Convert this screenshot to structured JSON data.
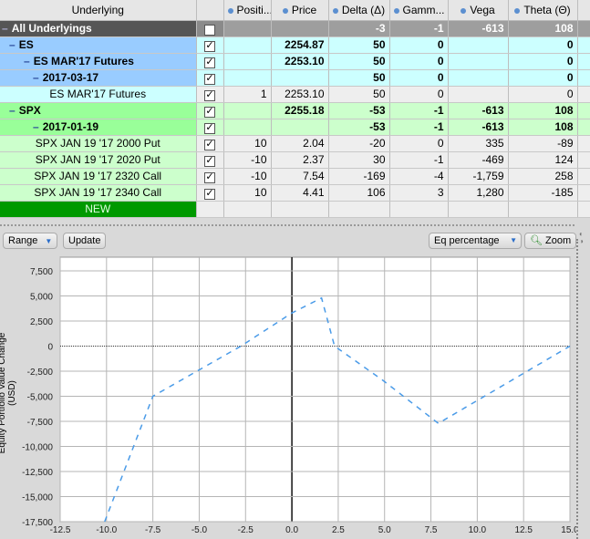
{
  "table": {
    "headers": [
      "Underlying",
      "",
      "Positi...",
      "Price",
      "Delta (Δ)",
      "Gamm...",
      "Vega",
      "Theta (Θ)"
    ],
    "rows": [
      {
        "label": "All Underlyings",
        "level": 0,
        "checked": "✓",
        "position": "",
        "price": "",
        "delta": "-3",
        "gamma": "-1",
        "vega": "-613",
        "theta": "108"
      },
      {
        "label": "ES",
        "level": 1,
        "checked": "✓",
        "position": "",
        "price": "2254.87",
        "delta": "50",
        "gamma": "0",
        "vega": "",
        "theta": "0"
      },
      {
        "label": "ES MAR'17 Futures",
        "level": 2,
        "checked": "✓",
        "position": "",
        "price": "2253.10",
        "delta": "50",
        "gamma": "0",
        "vega": "",
        "theta": "0"
      },
      {
        "label": "2017-03-17",
        "level": 3,
        "checked": "✓",
        "position": "",
        "price": "",
        "delta": "50",
        "gamma": "0",
        "vega": "",
        "theta": "0"
      },
      {
        "label": "ES MAR'17 Futures",
        "level": 4,
        "checked": "✓",
        "position": "1",
        "price": "2253.10",
        "delta": "50",
        "gamma": "0",
        "vega": "",
        "theta": "0"
      },
      {
        "label": "SPX",
        "level": 1,
        "checked": "✓",
        "position": "",
        "price": "2255.18",
        "delta": "-53",
        "gamma": "-1",
        "vega": "-613",
        "theta": "108"
      },
      {
        "label": "2017-01-19",
        "level": 3,
        "checked": "✓",
        "position": "",
        "price": "",
        "delta": "-53",
        "gamma": "-1",
        "vega": "-613",
        "theta": "108"
      },
      {
        "label": "SPX JAN 19 '17 2000 Put",
        "level": 4,
        "checked": "✓",
        "position": "10",
        "price": "2.04",
        "delta": "-20",
        "gamma": "0",
        "vega": "335",
        "theta": "-89"
      },
      {
        "label": "SPX JAN 19 '17 2020 Put",
        "level": 4,
        "checked": "✓",
        "position": "-10",
        "price": "2.37",
        "delta": "30",
        "gamma": "-1",
        "vega": "-469",
        "theta": "124"
      },
      {
        "label": "SPX JAN 19 '17 2320 Call",
        "level": 4,
        "checked": "✓",
        "position": "-10",
        "price": "7.54",
        "delta": "-169",
        "gamma": "-4",
        "vega": "-1,759",
        "theta": "258"
      },
      {
        "label": "SPX JAN 19 '17 2340 Call",
        "level": 4,
        "checked": "✓",
        "position": "10",
        "price": "4.41",
        "delta": "106",
        "gamma": "3",
        "vega": "1,280",
        "theta": "-185"
      }
    ],
    "new_label": "NEW",
    "minus_glyph": "–"
  },
  "toolbar": {
    "range_label": "Range",
    "update_label": "Update",
    "mode_label": "Eq percentage",
    "zoom_label": "Zoom"
  },
  "chart_data": {
    "type": "line",
    "title": "",
    "xlabel": "",
    "ylabel": "Equity Portfolio Value Change (USD)",
    "xlim": [
      -12.5,
      15.0
    ],
    "ylim": [
      -17500,
      7500
    ],
    "x_ticks": [
      "-12.5",
      "-10.0",
      "-7.5",
      "-5.0",
      "-2.5",
      "0.0",
      "2.5",
      "5.0",
      "7.5",
      "10.0",
      "12.5",
      "15.0"
    ],
    "y_ticks": [
      "7,500",
      "5,000",
      "2,500",
      "0",
      "-2,500",
      "-5,000",
      "-7,500",
      "-10,000",
      "-12,500",
      "-15,000",
      "-17,500"
    ],
    "grid": true,
    "series": [
      {
        "name": "Equity Portfolio Value Change",
        "color": "#4a9be8",
        "style": "dashed",
        "x": [
          -10.1,
          -7.5,
          -2.75,
          0.0,
          1.6,
          2.3,
          4.9,
          7.9,
          15.0
        ],
        "y": [
          -17500,
          -5000,
          0,
          3300,
          4800,
          0,
          -3400,
          -7700,
          0
        ]
      }
    ]
  }
}
